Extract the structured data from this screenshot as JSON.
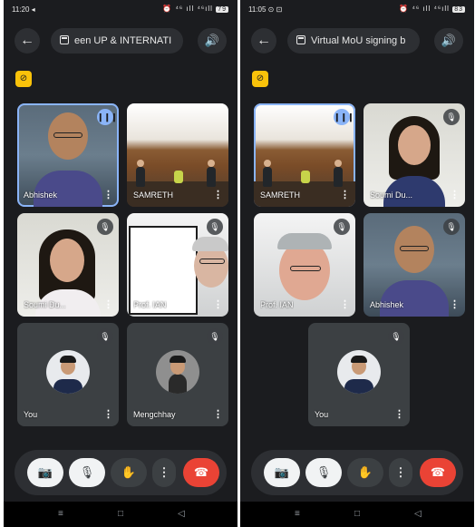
{
  "left": {
    "status": {
      "time": "11:20 ◂",
      "icons": "⏰ ⁴⁶ ıll ⁴⁶ıll",
      "battery": "79"
    },
    "meeting_title": "een UP & INTERNATI",
    "tiles": {
      "abhishek": "Abhishek",
      "samreth": "SAMRETH",
      "soumi": "Soumi Du...",
      "ian": "Prof. IAN",
      "you": "You",
      "mengchhay": "Mengchhay"
    },
    "menu_glyph": "⋮"
  },
  "right": {
    "status": {
      "time": "11:05 ⊙ ⊡",
      "icons": "⏰ ⁴⁶ ıll ⁴⁶ıll",
      "battery": "83"
    },
    "meeting_title": "Virtual MoU signing b",
    "tiles": {
      "samreth": "SAMRETH",
      "soumi": "Soumi Du...",
      "ian": "Prof. IAN",
      "abhishek": "Abhishek",
      "you": "You"
    },
    "menu_glyph": "⋮"
  },
  "icons": {
    "back": "←",
    "speaker": "🔊",
    "camera_off_badge": "⊘",
    "mic_off": "🎙",
    "speaking": "❙❙❙",
    "camera_off": "📷",
    "raise_hand": "✋",
    "more": "⋮",
    "end_call": "☎",
    "nav_recents": "≡",
    "nav_home": "□",
    "nav_back": "◁"
  },
  "colors": {
    "end_call": "#ea4335",
    "active_border": "#8ab4f8",
    "badge": "#f9c20a"
  }
}
